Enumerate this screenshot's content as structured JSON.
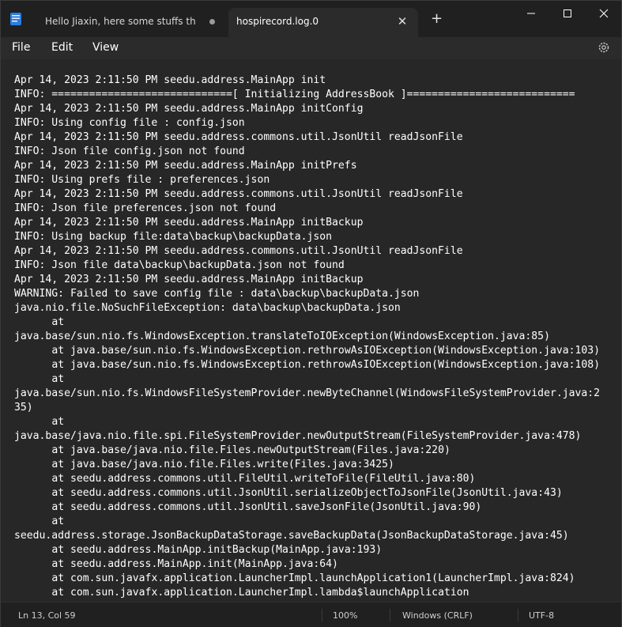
{
  "tabs": [
    {
      "label": "Hello Jiaxin, here some stuffs that",
      "icon": "notepad-icon",
      "modified": true
    },
    {
      "label": "hospirecord.log.0",
      "active": true
    }
  ],
  "menu": {
    "file": "File",
    "edit": "Edit",
    "view": "View"
  },
  "status": {
    "position": "Ln 13, Col 59",
    "zoom": "100%",
    "line_ending": "Windows (CRLF)",
    "encoding": "UTF-8"
  },
  "log_lines": [
    "Apr 14, 2023 2:11:50 PM seedu.address.MainApp init",
    "INFO: =============================[ Initializing AddressBook ]===========================",
    "Apr 14, 2023 2:11:50 PM seedu.address.MainApp initConfig",
    "INFO: Using config file : config.json",
    "Apr 14, 2023 2:11:50 PM seedu.address.commons.util.JsonUtil readJsonFile",
    "INFO: Json file config.json not found",
    "Apr 14, 2023 2:11:50 PM seedu.address.MainApp initPrefs",
    "INFO: Using prefs file : preferences.json",
    "Apr 14, 2023 2:11:50 PM seedu.address.commons.util.JsonUtil readJsonFile",
    "INFO: Json file preferences.json not found",
    "Apr 14, 2023 2:11:50 PM seedu.address.MainApp initBackup",
    "INFO: Using backup file:data\\backup\\backupData.json",
    "Apr 14, 2023 2:11:50 PM seedu.address.commons.util.JsonUtil readJsonFile",
    "INFO: Json file data\\backup\\backupData.json not found",
    "Apr 14, 2023 2:11:50 PM seedu.address.MainApp initBackup",
    "WARNING: Failed to save config file : data\\backup\\backupData.json",
    "java.nio.file.NoSuchFileException: data\\backup\\backupData.json",
    "      at",
    "java.base/sun.nio.fs.WindowsException.translateToIOException(WindowsException.java:85)",
    "      at java.base/sun.nio.fs.WindowsException.rethrowAsIOException(WindowsException.java:103)",
    "      at java.base/sun.nio.fs.WindowsException.rethrowAsIOException(WindowsException.java:108)",
    "      at",
    "java.base/sun.nio.fs.WindowsFileSystemProvider.newByteChannel(WindowsFileSystemProvider.java:2",
    "35)",
    "      at",
    "java.base/java.nio.file.spi.FileSystemProvider.newOutputStream(FileSystemProvider.java:478)",
    "      at java.base/java.nio.file.Files.newOutputStream(Files.java:220)",
    "      at java.base/java.nio.file.Files.write(Files.java:3425)",
    "      at seedu.address.commons.util.FileUtil.writeToFile(FileUtil.java:80)",
    "      at seedu.address.commons.util.JsonUtil.serializeObjectToJsonFile(JsonUtil.java:43)",
    "      at seedu.address.commons.util.JsonUtil.saveJsonFile(JsonUtil.java:90)",
    "      at",
    "seedu.address.storage.JsonBackupDataStorage.saveBackupData(JsonBackupDataStorage.java:45)",
    "      at seedu.address.MainApp.initBackup(MainApp.java:193)",
    "      at seedu.address.MainApp.init(MainApp.java:64)",
    "      at com.sun.javafx.application.LauncherImpl.launchApplication1(LauncherImpl.java:824)",
    "      at com.sun.javafx.application.LauncherImpl.lambda$launchApplication"
  ]
}
